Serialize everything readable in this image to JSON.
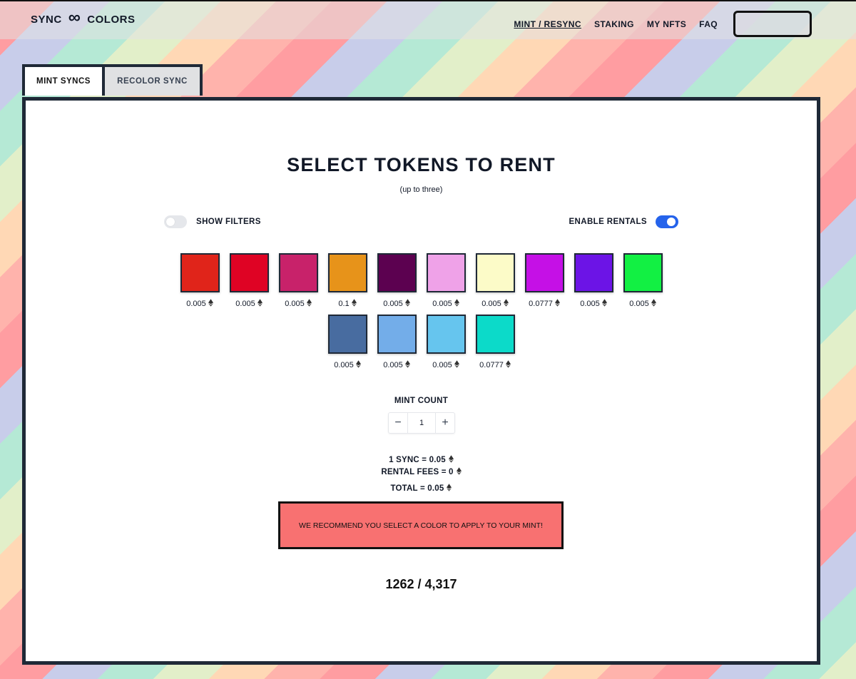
{
  "header": {
    "logo_left": "SYNC",
    "logo_symbol": "∞",
    "logo_right": "COLORS",
    "nav": {
      "mint": "MINT / RESYNC",
      "staking": "STAKING",
      "my_nfts": "MY NFTS",
      "faq": "FAQ"
    },
    "wallet_button": ""
  },
  "tabs": {
    "mint": "MINT SYNCS",
    "recolor": "RECOLOR SYNC",
    "active": "MINT SYNCS"
  },
  "main": {
    "title": "SELECT TOKENS TO RENT",
    "subtitle": "(up to three)",
    "show_filters_label": "SHOW FILTERS",
    "show_filters_on": false,
    "enable_rentals_label": "ENABLE RENTALS",
    "enable_rentals_on": true
  },
  "tokens": [
    {
      "color": "#e0241a",
      "price": "0.005"
    },
    {
      "color": "#df0324",
      "price": "0.005"
    },
    {
      "color": "#c8226a",
      "price": "0.005"
    },
    {
      "color": "#e7931a",
      "price": "0.1"
    },
    {
      "color": "#5c0150",
      "price": "0.005"
    },
    {
      "color": "#efa2e8",
      "price": "0.005"
    },
    {
      "color": "#fcfbc8",
      "price": "0.005"
    },
    {
      "color": "#c510e6",
      "price": "0.0777"
    },
    {
      "color": "#6c14e6",
      "price": "0.005"
    },
    {
      "color": "#12f043",
      "price": "0.005"
    },
    {
      "color": "#486ca0",
      "price": "0.005"
    },
    {
      "color": "#73ade9",
      "price": "0.005"
    },
    {
      "color": "#66c5ee",
      "price": "0.005"
    },
    {
      "color": "#0cdac9",
      "price": "0.0777"
    }
  ],
  "mint": {
    "label": "MINT COUNT",
    "minus": "−",
    "count": "1",
    "plus": "+"
  },
  "summary": {
    "sync_price": "1 SYNC = 0.05",
    "rental_fees": "RENTAL FEES = 0",
    "total": "TOTAL = 0.05"
  },
  "warning": "WE RECOMMEND YOU SELECT A COLOR TO APPLY TO YOUR MINT!",
  "counter": "1262 / 4,317",
  "icons": {
    "currency": "eth-icon"
  }
}
